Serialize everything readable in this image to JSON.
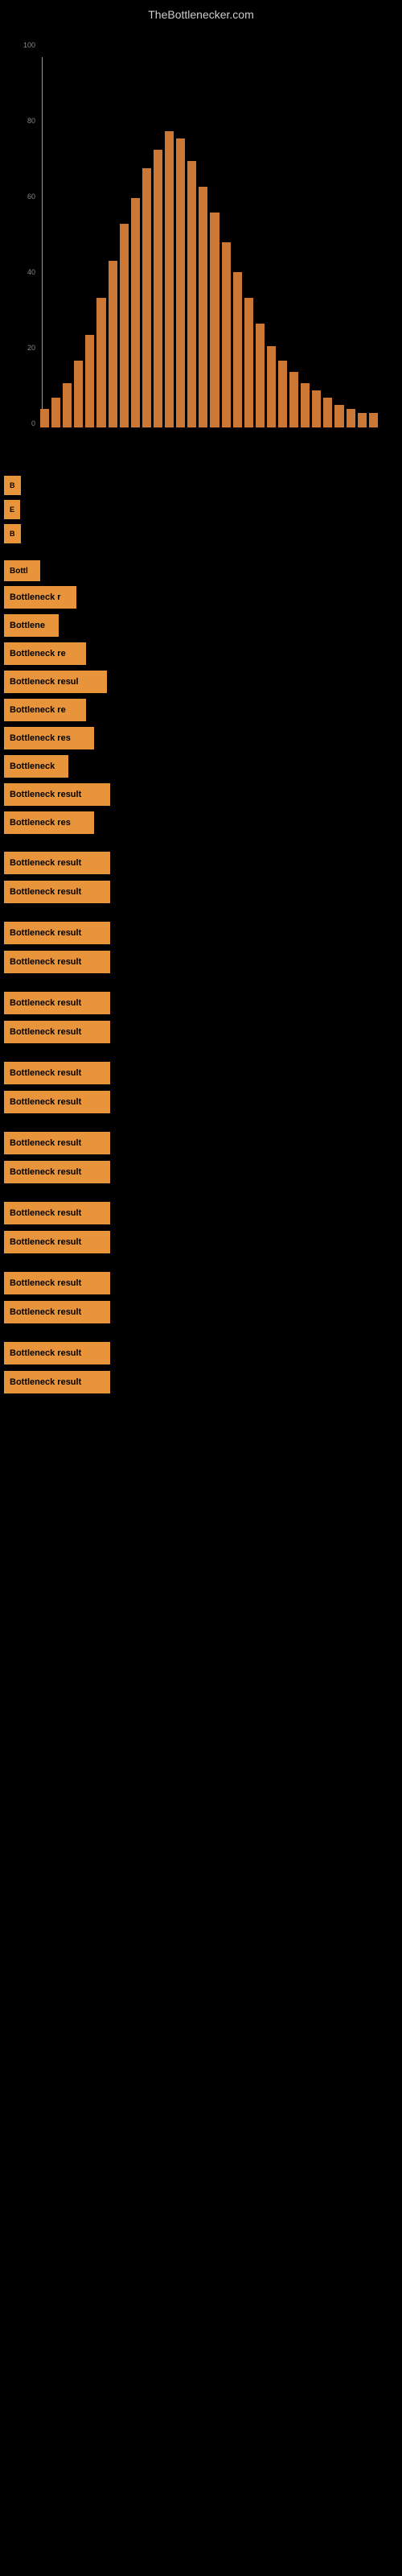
{
  "site": {
    "title": "TheBottlenecker.com"
  },
  "chart": {
    "axis_left_labels": [
      "100",
      "80",
      "60",
      "40",
      "20",
      "0"
    ],
    "axis_bottom_labels": [
      "",
      "",
      "",
      "",
      "",
      "",
      "",
      "",
      "",
      ""
    ],
    "bars": [
      5,
      8,
      12,
      18,
      25,
      35,
      45,
      55,
      62,
      70,
      75,
      80,
      78,
      72,
      65,
      58,
      50,
      42,
      35,
      28,
      22,
      18,
      15,
      12,
      10,
      8,
      6,
      5,
      4,
      4
    ]
  },
  "results": {
    "section_labels": [
      "Bottleneck result",
      "Bottleneck result",
      "Bottleneck result"
    ],
    "items": [
      {
        "label": "B",
        "width": 18,
        "bar_pct": 0
      },
      {
        "label": "E",
        "width": 18,
        "bar_pct": 0
      },
      {
        "label": "B",
        "width": 18,
        "bar_pct": 0
      },
      {
        "label": "Bottl",
        "width": 45,
        "bar_pct": 5
      },
      {
        "label": "Bottleneck r",
        "width": 90,
        "bar_pct": 10
      },
      {
        "label": "Bottlene",
        "width": 65,
        "bar_pct": 8
      },
      {
        "label": "Bottleneck re",
        "width": 100,
        "bar_pct": 15
      },
      {
        "label": "Bottleneck resul",
        "width": 125,
        "bar_pct": 20
      },
      {
        "label": "Bottleneck re",
        "width": 100,
        "bar_pct": 15
      },
      {
        "label": "Bottleneck res",
        "width": 110,
        "bar_pct": 18
      },
      {
        "label": "Bottleneck",
        "width": 80,
        "bar_pct": 12
      },
      {
        "label": "Bottleneck result",
        "width": 130,
        "bar_pct": 22
      },
      {
        "label": "Bottleneck res",
        "width": 110,
        "bar_pct": 18
      },
      {
        "label": "Bottleneck result",
        "width": 130,
        "bar_pct": 22
      },
      {
        "label": "Bottleneck result",
        "width": 130,
        "bar_pct": 25
      },
      {
        "label": "Bottleneck result",
        "width": 130,
        "bar_pct": 28
      },
      {
        "label": "Bottleneck result",
        "width": 130,
        "bar_pct": 30
      },
      {
        "label": "Bottleneck result",
        "width": 130,
        "bar_pct": 32
      },
      {
        "label": "Bottleneck result",
        "width": 130,
        "bar_pct": 35
      },
      {
        "label": "Bottleneck result",
        "width": 130,
        "bar_pct": 38
      },
      {
        "label": "Bottleneck result",
        "width": 130,
        "bar_pct": 40
      },
      {
        "label": "Bottleneck result",
        "width": 130,
        "bar_pct": 42
      },
      {
        "label": "Bottleneck result",
        "width": 130,
        "bar_pct": 45
      },
      {
        "label": "Bottleneck result",
        "width": 130,
        "bar_pct": 48
      },
      {
        "label": "Bottleneck result",
        "width": 130,
        "bar_pct": 50
      },
      {
        "label": "Bottleneck result",
        "width": 130,
        "bar_pct": 52
      },
      {
        "label": "Bottleneck result",
        "width": 130,
        "bar_pct": 55
      }
    ]
  }
}
